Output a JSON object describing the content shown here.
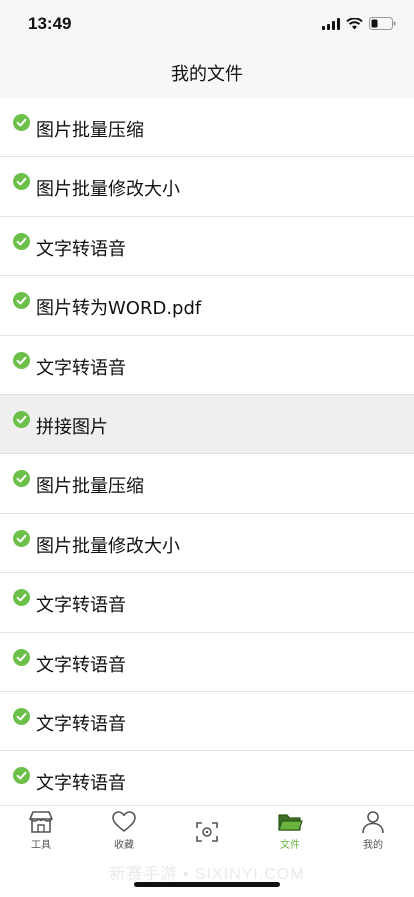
{
  "status_bar": {
    "time": "13:49"
  },
  "nav": {
    "title": "我的文件"
  },
  "files": [
    {
      "name": "图片批量压缩",
      "selected": false
    },
    {
      "name": "图片批量修改大小",
      "selected": false
    },
    {
      "name": "文字转语音",
      "selected": false
    },
    {
      "name": "图片转为WORD.pdf",
      "selected": false
    },
    {
      "name": "文字转语音",
      "selected": false
    },
    {
      "name": "拼接图片",
      "selected": true
    },
    {
      "name": "图片批量压缩",
      "selected": false
    },
    {
      "name": "图片批量修改大小",
      "selected": false
    },
    {
      "name": "文字转语音",
      "selected": false
    },
    {
      "name": "文字转语音",
      "selected": false
    },
    {
      "name": "文字转语音",
      "selected": false
    },
    {
      "name": "文字转语音",
      "selected": false
    }
  ],
  "tabs": [
    {
      "label": "工具",
      "icon": "store-icon",
      "active": false
    },
    {
      "label": "收藏",
      "icon": "heart-icon",
      "active": false
    },
    {
      "label": "",
      "icon": "scan-icon",
      "active": false
    },
    {
      "label": "文件",
      "icon": "folder-icon",
      "active": true
    },
    {
      "label": "我的",
      "icon": "person-icon",
      "active": false
    }
  ],
  "watermark": "新赛手游 • SIXINYI.COM",
  "colors": {
    "accent": "#6db33f",
    "check": "#6cc04a",
    "selected_row": "#efefef"
  }
}
